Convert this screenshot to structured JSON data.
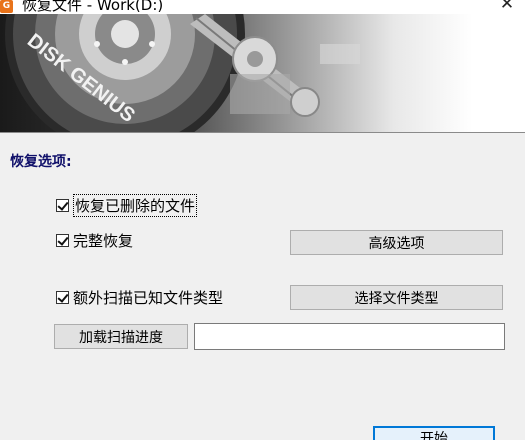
{
  "window": {
    "title": "恢复文件 - Work(D:)",
    "app_icon_letter": "G",
    "close_glyph": "✕"
  },
  "banner": {
    "brand_text": "DISK GENIUS"
  },
  "options": {
    "section_title": "恢复选项:",
    "recover_deleted": {
      "label": "恢复已删除的文件",
      "checked": true
    },
    "full_recovery": {
      "label": "完整恢复",
      "checked": true
    },
    "extra_scan": {
      "label": "额外扫描已知文件类型",
      "checked": true
    }
  },
  "buttons": {
    "advanced": "高级选项",
    "select_types": "选择文件类型",
    "load_progress": "加载扫描进度",
    "start": "开始"
  },
  "progress_path": {
    "value": ""
  }
}
